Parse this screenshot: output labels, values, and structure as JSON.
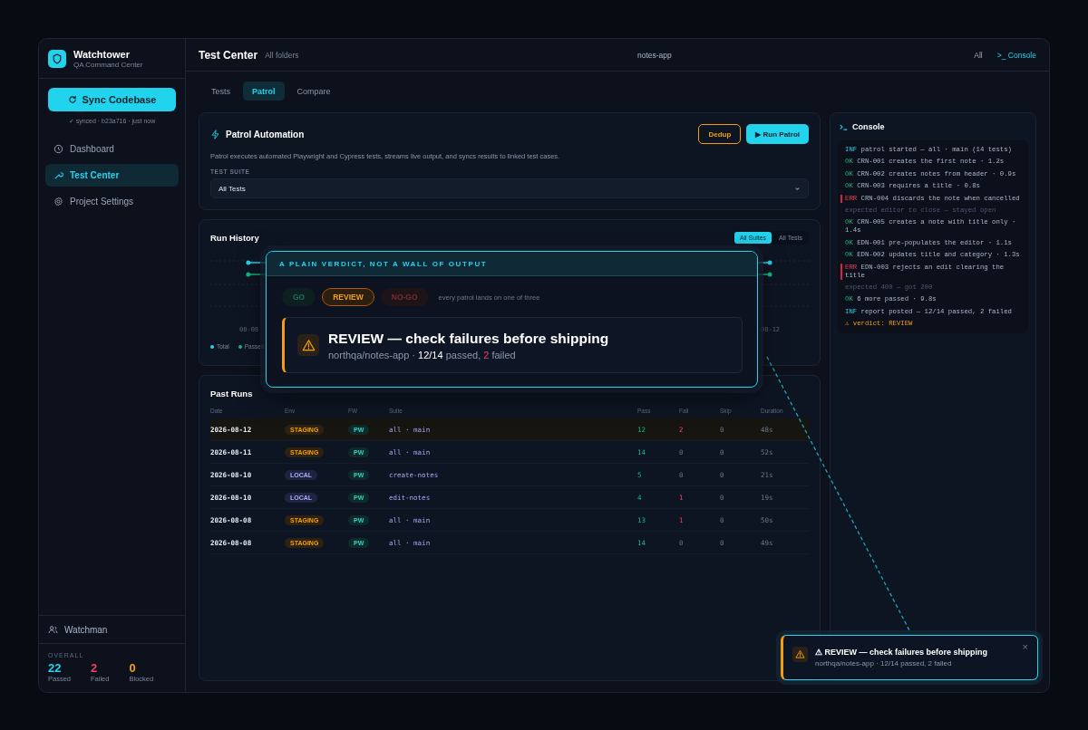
{
  "sidebar": {
    "brand": {
      "title": "Watchtower",
      "subtitle": "QA Command Center"
    },
    "sync_button": "Sync Codebase",
    "sync_status": "✓ synced · b23a716 · just now",
    "items": [
      {
        "label": "Dashboard",
        "selected": false
      },
      {
        "label": "Test Center",
        "selected": true
      },
      {
        "label": "Project Settings",
        "selected": false
      }
    ],
    "user": "Watchman",
    "overall_label": "OVERALL",
    "stats": [
      {
        "value": "22",
        "label": "Passed",
        "color": "#22d3ee"
      },
      {
        "value": "2",
        "label": "Failed",
        "color": "#f43f5e"
      },
      {
        "value": "0",
        "label": "Blocked",
        "color": "#f59e0b"
      }
    ]
  },
  "header": {
    "title": "Test Center",
    "scope": "All folders",
    "project": "notes-app",
    "filter": "All",
    "console_link": ">_ Console"
  },
  "tabs": [
    {
      "label": "Tests",
      "selected": false
    },
    {
      "label": "Patrol",
      "selected": true
    },
    {
      "label": "Compare",
      "selected": false
    }
  ],
  "patrol": {
    "title": "Patrol Automation",
    "buttons": [
      {
        "label": "Dedup",
        "kind": "outline"
      },
      {
        "label": "▶ Run Patrol",
        "kind": "primary"
      }
    ],
    "description": "Patrol executes automated Playwright and Cypress tests, streams live output, and syncs results to linked test cases.",
    "suite_label": "TEST SUITE",
    "suite_value": "All Tests"
  },
  "run_history": {
    "title": "Run History",
    "filters": [
      {
        "label": "All Suites",
        "selected": true
      },
      {
        "label": "All Tests",
        "selected": false
      }
    ],
    "x_labels": [
      "08-08",
      "08-12"
    ],
    "legend": [
      {
        "label": "Total",
        "color": "#22d3ee"
      },
      {
        "label": "Passed",
        "color": "#10b981"
      }
    ]
  },
  "past_runs": {
    "title": "Past Runs",
    "columns": [
      "Date",
      "Env",
      "FW",
      "Suite",
      "Pass",
      "Fail",
      "Skip",
      "Duration"
    ],
    "rows": [
      {
        "date": "2026-08-12",
        "env": {
          "label": "STAGING",
          "kind": "staging"
        },
        "fw": "PW",
        "suite": "all · main",
        "pass": "12",
        "fail": "2",
        "has_failures": true,
        "skip": "0",
        "duration": "48s",
        "selected": true
      },
      {
        "date": "2026-08-11",
        "env": {
          "label": "STAGING",
          "kind": "staging"
        },
        "fw": "PW",
        "suite": "all · main",
        "pass": "14",
        "fail": "0",
        "has_failures": false,
        "skip": "0",
        "duration": "52s",
        "selected": false
      },
      {
        "date": "2026-08-10",
        "env": {
          "label": "LOCAL",
          "kind": "local"
        },
        "fw": "PW",
        "suite": "create-notes",
        "pass": "5",
        "fail": "0",
        "has_failures": false,
        "skip": "0",
        "duration": "21s",
        "selected": false
      },
      {
        "date": "2026-08-10",
        "env": {
          "label": "LOCAL",
          "kind": "local"
        },
        "fw": "PW",
        "suite": "edit-notes",
        "pass": "4",
        "fail": "1",
        "has_failures": true,
        "skip": "0",
        "duration": "19s",
        "selected": false
      },
      {
        "date": "2026-08-08",
        "env": {
          "label": "STAGING",
          "kind": "staging"
        },
        "fw": "PW",
        "suite": "all · main",
        "pass": "13",
        "fail": "1",
        "has_failures": true,
        "skip": "0",
        "duration": "50s",
        "selected": false
      },
      {
        "date": "2026-08-08",
        "env": {
          "label": "STAGING",
          "kind": "staging"
        },
        "fw": "PW",
        "suite": "all · main",
        "pass": "14",
        "fail": "0",
        "has_failures": false,
        "skip": "0",
        "duration": "49s",
        "selected": false
      }
    ]
  },
  "console": {
    "title": "Console",
    "lines": [
      {
        "kind": "inf",
        "tag": "INF",
        "text": "patrol started — all · main (14 tests)"
      },
      {
        "kind": "ok",
        "tag": "OK",
        "text": "CRN-001 creates the first note · 1.2s"
      },
      {
        "kind": "ok",
        "tag": "OK",
        "text": "CRN-002 creates notes from header · 0.9s"
      },
      {
        "kind": "ok",
        "tag": "OK",
        "text": "CRN-003 requires a title · 0.8s"
      },
      {
        "kind": "err",
        "tag": "ERR",
        "text": "CRN-004 discards the note when cancelled"
      },
      {
        "kind": "detail",
        "text": "expected editor to close — stayed open"
      },
      {
        "kind": "ok",
        "tag": "OK",
        "text": "CRN-005 creates a note with title only · 1.4s"
      },
      {
        "kind": "ok",
        "tag": "OK",
        "text": "EDN-001 pre-populates the editor · 1.1s"
      },
      {
        "kind": "ok",
        "tag": "OK",
        "text": "EDN-002 updates title and category · 1.3s"
      },
      {
        "kind": "err",
        "tag": "ERR",
        "text": "EDN-003 rejects an edit clearing the title"
      },
      {
        "kind": "detail",
        "text": "expected 400 — got 200"
      },
      {
        "kind": "ok",
        "tag": "OK",
        "text": "6 more passed · 9.8s"
      },
      {
        "kind": "inf",
        "tag": "INF",
        "text": "report posted — 12/14 passed, 2 failed"
      },
      {
        "kind": "warn",
        "text": "⚠ verdict: REVIEW"
      }
    ]
  },
  "callout": {
    "heading": "A PLAIN VERDICT, NOT A WALL OF OUTPUT",
    "verdicts": [
      {
        "label": "GO",
        "kind": "go",
        "selected": false
      },
      {
        "label": "REVIEW",
        "kind": "review",
        "selected": true
      },
      {
        "label": "NO-GO",
        "kind": "nogo",
        "selected": false
      }
    ],
    "verdict_note": "every patrol lands on one of three",
    "title": "REVIEW — check failures before shipping",
    "summary": {
      "repo": "northqa/notes-app · ",
      "passed": "12/14",
      "passed_word": " passed, ",
      "failed": "2",
      "failed_word": " failed"
    }
  },
  "toast": {
    "title": "⚠ REVIEW — check failures before shipping",
    "message": "northqa/notes-app · 12/14 passed, 2 failed",
    "close": "×"
  }
}
